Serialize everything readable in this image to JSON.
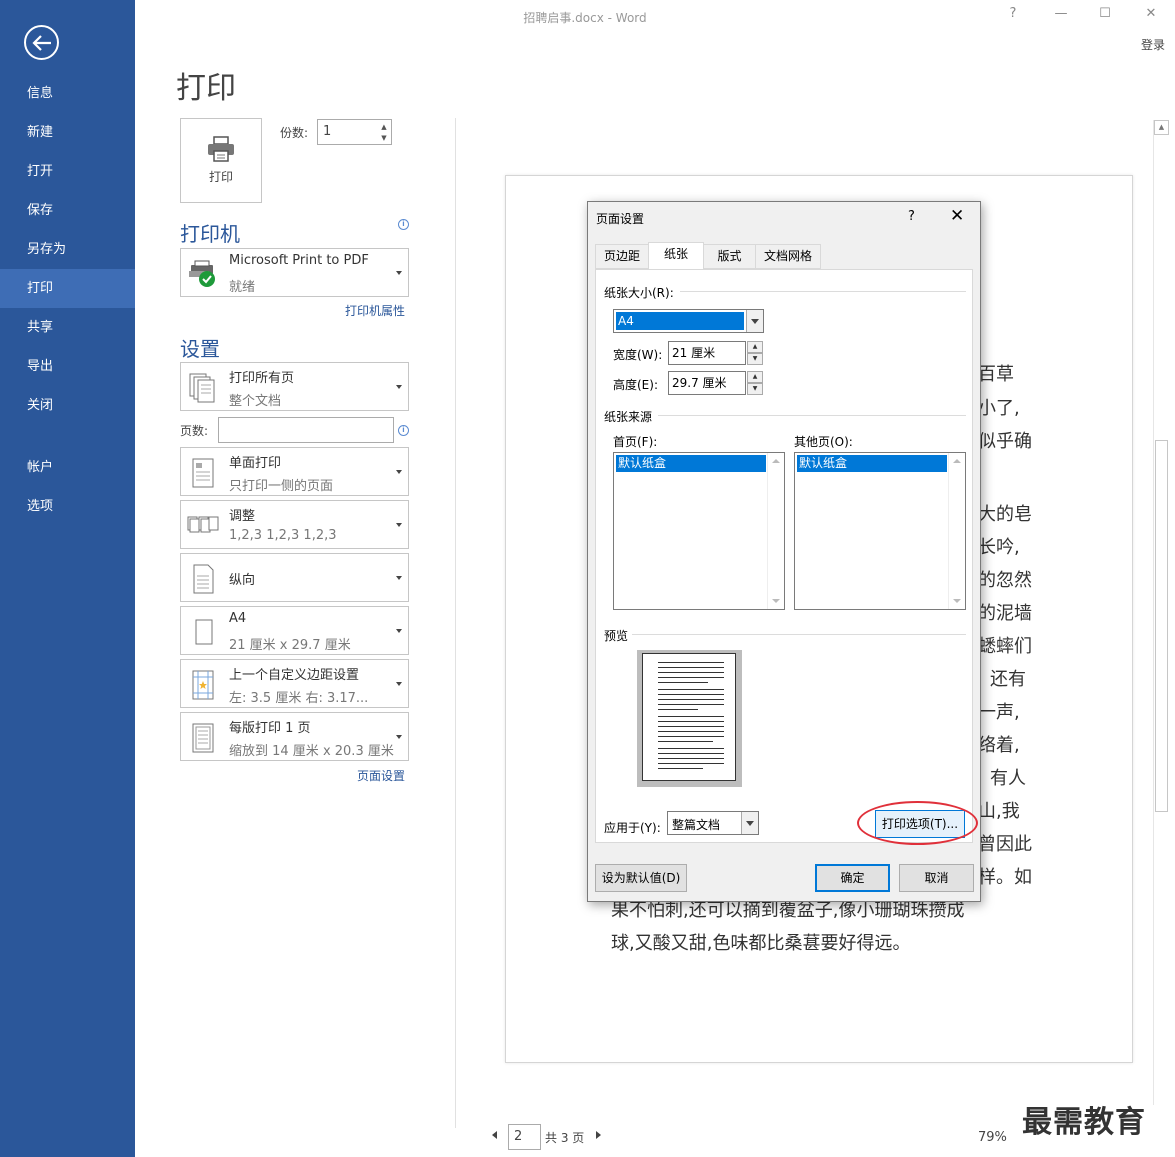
{
  "titlebar": {
    "title": "招聘启事.docx - Word",
    "help": "?",
    "minimize": "—",
    "maximize": "☐",
    "close": "✕",
    "login": "登录"
  },
  "sidebar": {
    "items": [
      "信息",
      "新建",
      "打开",
      "保存",
      "另存为",
      "打印",
      "共享",
      "导出",
      "关闭"
    ],
    "bottom_items": [
      "帐户",
      "选项"
    ],
    "active": "打印",
    "bg_color": "#2b579a"
  },
  "print": {
    "heading": "打印",
    "print_button_label": "打印",
    "copies_label": "份数:",
    "copies_value": "1",
    "printer_heading": "打印机",
    "printer_name": "Microsoft Print to PDF",
    "printer_status": "就绪",
    "printer_props_link": "打印机属性",
    "settings_heading": "设置",
    "pages_label": "页数:",
    "pages_value": "",
    "settings": [
      {
        "line1": "打印所有页",
        "line2": "整个文档"
      },
      {
        "line1": "单面打印",
        "line2": "只打印一侧的页面"
      },
      {
        "line1": "调整",
        "line2": "1,2,3    1,2,3    1,2,3"
      },
      {
        "line1": "纵向",
        "line2": ""
      },
      {
        "line1": "A4",
        "line2": "21 厘米 x 29.7 厘米"
      },
      {
        "line1": "上一个自定义边距设置",
        "line2": "左: 3.5 厘米    右: 3.17..."
      },
      {
        "line1": "每版打印 1 页",
        "line2": "缩放到 14 厘米 x 20.3 厘米"
      }
    ],
    "page_setup_link": "页面设置"
  },
  "preview": {
    "visible_text_right": [
      "百草",
      "小了,",
      "似乎确",
      "大的皂",
      "长吟,",
      "的忽然",
      "的泥墙",
      "蟋蟀们",
      "还有",
      "一声,",
      "络着,",
      "有人",
      "山,我",
      "曾因此",
      "样。如"
    ],
    "visible_text_bottom": [
      "果不怕刺,还可以摘到覆盆子,像小珊瑚珠攒成",
      "球,又酸又甜,色味都比桑葚要好得远。"
    ],
    "current_page": "2",
    "total_pages": "共 3 页",
    "zoom": "79%",
    "watermark": "最需教育"
  },
  "dialog": {
    "title": "页面设置",
    "help": "?",
    "close": "✕",
    "tabs": [
      "页边距",
      "纸张",
      "版式",
      "文档网格"
    ],
    "active_tab": "纸张",
    "paper_size_label": "纸张大小(R):",
    "paper_size_value": "A4",
    "width_label": "宽度(W):",
    "width_value": "21 厘米",
    "height_label": "高度(E):",
    "height_value": "29.7 厘米",
    "paper_source_label": "纸张来源",
    "first_page_label": "首页(F):",
    "first_page_value": "默认纸盒",
    "other_pages_label": "其他页(O):",
    "other_pages_value": "默认纸盒",
    "preview_label": "预览",
    "apply_to_label": "应用于(Y):",
    "apply_to_value": "整篇文档",
    "print_options_button": "打印选项(T)...",
    "set_default_button": "设为默认值(D)",
    "ok_button": "确定",
    "cancel_button": "取消",
    "highlight_color": "#e0303a"
  }
}
